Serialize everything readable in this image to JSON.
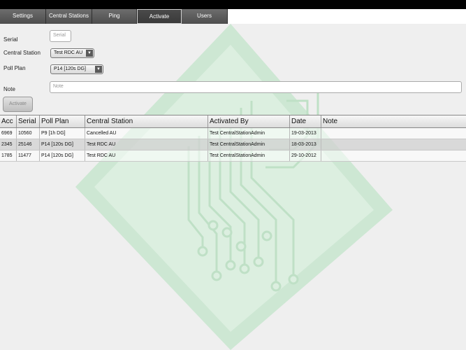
{
  "tabs": [
    {
      "label": "Settings",
      "active": false
    },
    {
      "label": "Central Stations",
      "active": false
    },
    {
      "label": "Ping",
      "active": false
    },
    {
      "label": "Activate",
      "active": true
    },
    {
      "label": "Users",
      "active": false
    }
  ],
  "form": {
    "serial_label": "Serial",
    "serial_placeholder": "Serial",
    "central_station_label": "Central Station",
    "central_station_value": "Test RDC AU",
    "poll_plan_label": "Poll Plan",
    "poll_plan_value": "P14 [120s DG]",
    "note_label": "Note",
    "note_placeholder": "Note",
    "activate_button": "Activate"
  },
  "table": {
    "columns": [
      "Acc",
      "Serial",
      "Poll Plan",
      "Central Station",
      "Activated By",
      "Date",
      "Note"
    ],
    "rows": [
      [
        "6969",
        "10560",
        "P9 [1h DG]",
        "Cancelled AU",
        "Test CentralStationAdmin",
        "19-03-2013",
        ""
      ],
      [
        "2345",
        "25146",
        "P14 [120s DG]",
        "Test RDC AU",
        "Test CentralStationAdmin",
        "18-03-2013",
        ""
      ],
      [
        "1785",
        "11477",
        "P14 [120s DG]",
        "Test RDC AU",
        "Test CentralStationAdmin",
        "29-10-2012",
        ""
      ]
    ]
  },
  "colors": {
    "watermark_green": "#c9e5cf",
    "panel_bg": "#efefef",
    "tab_bg": "#5a5a5a"
  }
}
